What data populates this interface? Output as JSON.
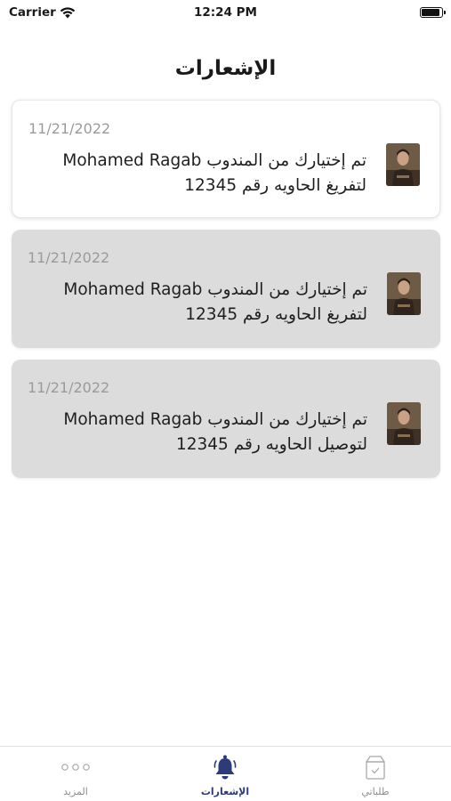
{
  "status_bar": {
    "carrier": "Carrier",
    "time": "12:24 PM",
    "battery_level": 0.95
  },
  "header": {
    "title": "الإشعارات"
  },
  "notifications": [
    {
      "date": "11/21/2022",
      "text": "تم إختيارك من المندوب Mohamed Ragab لتفريغ الحاويه رقم 12345",
      "avatar_icon": "user-avatar",
      "read": true
    },
    {
      "date": "11/21/2022",
      "text": "تم إختيارك من المندوب Mohamed Ragab لتفريغ الحاويه رقم 12345",
      "avatar_icon": "user-avatar",
      "read": false
    },
    {
      "date": "11/21/2022",
      "text": "تم إختيارك من المندوب Mohamed Ragab لتوصيل الحاويه رقم 12345",
      "avatar_icon": "user-avatar",
      "read": false
    }
  ],
  "tab_bar": {
    "more_label": "المزيد",
    "notifications_label": "الإشعارات",
    "orders_label": "طلباتي",
    "active_tab": "notifications"
  },
  "colors": {
    "accent": "#2b3c78",
    "card_read_bg": "#ffffff",
    "card_unread_bg": "#dcdcdc",
    "inactive_tab": "#8d8d8d"
  }
}
